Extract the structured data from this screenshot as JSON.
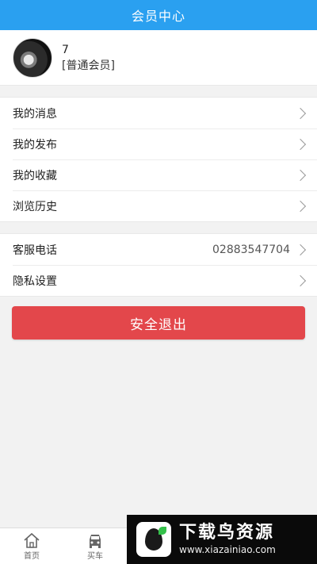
{
  "header": {
    "title": "会员中心"
  },
  "profile": {
    "username": "7",
    "level": "[普通会员]"
  },
  "menu_group_1": [
    {
      "label": "我的消息"
    },
    {
      "label": "我的发布"
    },
    {
      "label": "我的收藏"
    },
    {
      "label": "浏览历史"
    }
  ],
  "menu_group_2": [
    {
      "label": "客服电话",
      "value": "02883547704"
    },
    {
      "label": "隐私设置"
    }
  ],
  "logout": {
    "label": "安全退出"
  },
  "tabbar": [
    {
      "label": "首页",
      "icon": "home-icon"
    },
    {
      "label": "买车",
      "icon": "car-icon"
    }
  ],
  "watermark": {
    "title": "下载鸟资源",
    "url": "www.xiazainiao.com"
  },
  "colors": {
    "header": "#2aa0f0",
    "logout": "#e3474b",
    "background": "#f2f2f2"
  }
}
